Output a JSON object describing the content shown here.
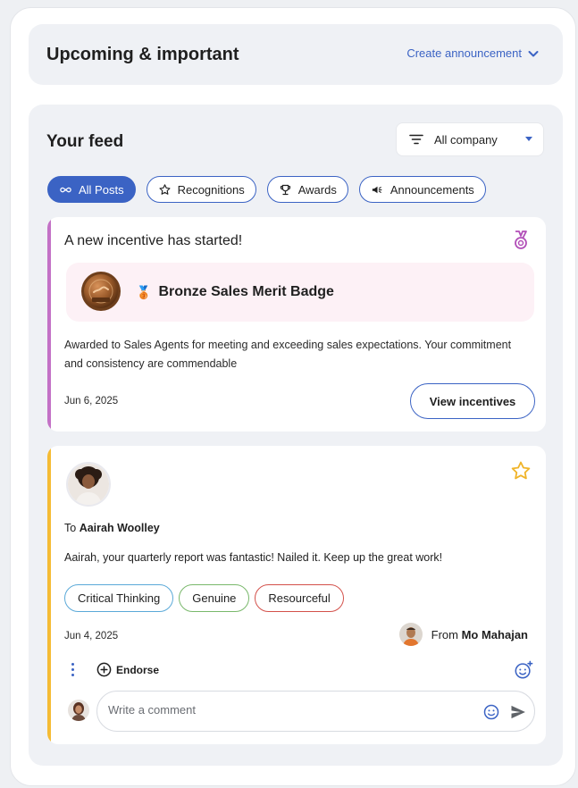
{
  "upcoming": {
    "title": "Upcoming & important",
    "create_label": "Create announcement"
  },
  "feed": {
    "title": "Your feed",
    "filter": {
      "selected": "All company"
    },
    "chips": [
      {
        "label": "All Posts",
        "icon": "infinity-icon",
        "active": true
      },
      {
        "label": "Recognitions",
        "icon": "star-icon",
        "active": false
      },
      {
        "label": "Awards",
        "icon": "trophy-icon",
        "active": false
      },
      {
        "label": "Announcements",
        "icon": "megaphone-icon",
        "active": false
      }
    ]
  },
  "incentive_card": {
    "title": "A new incentive has started!",
    "badge_emoji": "🥉",
    "badge_name": "Bronze Sales Merit Badge",
    "description": "Awarded to Sales Agents for meeting and exceeding sales expectations. Your commitment and consistency are commendable",
    "date": "Jun 6, 2025",
    "button_label": "View incentives",
    "accent_color": "#c371c6"
  },
  "recognition_card": {
    "to_prefix": "To",
    "recipient": "Aairah Woolley",
    "message": "Aairah, your quarterly report was fantastic! Nailed it. Keep up the great work!",
    "tags": [
      {
        "label": "Critical Thinking",
        "color": "#5aa9d8"
      },
      {
        "label": "Genuine",
        "color": "#79b86b"
      },
      {
        "label": "Resourceful",
        "color": "#d3504a"
      }
    ],
    "date": "Jun 4, 2025",
    "from_prefix": "From",
    "sender": "Mo Mahajan",
    "endorse_label": "Endorse",
    "comment_placeholder": "Write a comment",
    "accent_color": "#f5bb34"
  }
}
